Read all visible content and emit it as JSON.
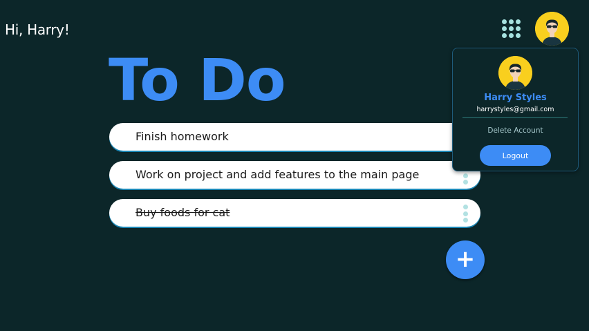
{
  "header": {
    "greeting": "Hi, Harry!",
    "apps_icon": "grid-icon",
    "avatar_icon": "user-avatar-icon"
  },
  "main": {
    "title": "To Do",
    "tasks": [
      {
        "text": "Finish homework",
        "completed": false
      },
      {
        "text": "Work on project and add features to the main page",
        "completed": false
      },
      {
        "text": "Buy foods for cat",
        "completed": true
      }
    ],
    "add_button_label": "+"
  },
  "profile_menu": {
    "name": "Harry Styles",
    "email": "harrystyles@gmail.com",
    "delete_account_label": "Delete Account",
    "logout_label": "Logout"
  },
  "colors": {
    "background": "#0c2629",
    "accent": "#3d8cf5",
    "avatar_bg": "#f9cf1e",
    "apps_dots": "#a6e2e0",
    "task_bg": "#ffffff"
  }
}
